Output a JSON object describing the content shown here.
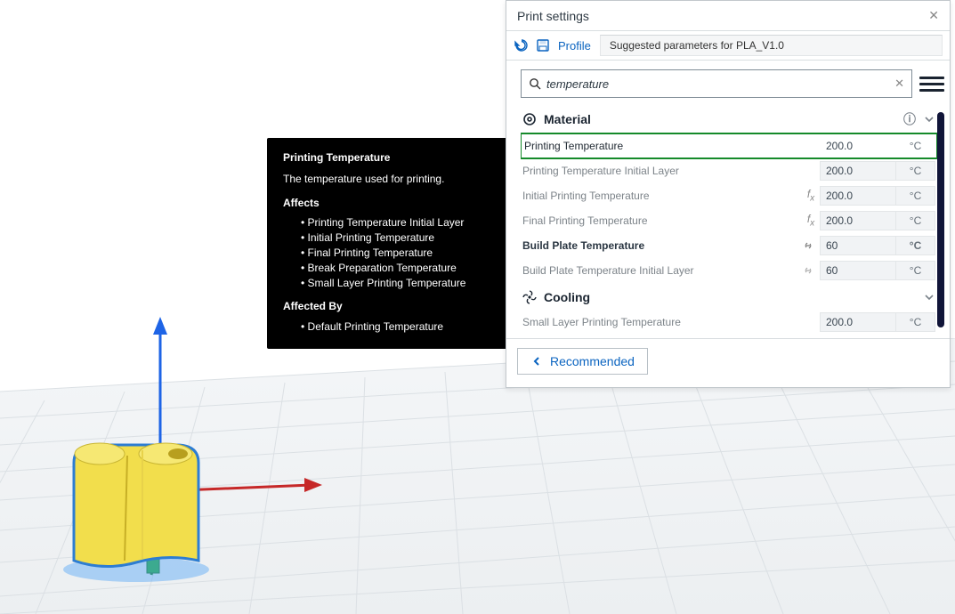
{
  "tooltip": {
    "title": "Printing Temperature",
    "desc": "The temperature used for printing.",
    "affects_label": "Affects",
    "affects": [
      "Printing Temperature Initial Layer",
      "Initial Printing Temperature",
      "Final Printing Temperature",
      "Break Preparation Temperature",
      "Small Layer Printing Temperature"
    ],
    "affected_by_label": "Affected By",
    "affected_by": [
      "Default Printing Temperature"
    ]
  },
  "panel": {
    "title": "Print settings",
    "close_glyph": "✕",
    "undo_glyph": "↺",
    "save_glyph": "🖫",
    "profile_label": "Profile",
    "profile_value": "Suggested parameters for PLA_V1.0",
    "search_value": "temperature",
    "search_glyph": "🔍",
    "search_clear": "✕",
    "info_glyph": "ⓘ",
    "sections": {
      "material": {
        "title": "Material",
        "icon": "material-icon",
        "rows": [
          {
            "label": "Printing Temperature",
            "value": "200.0",
            "unit": "°C",
            "name": "printing-temperature",
            "highlight": true,
            "enabled": true
          },
          {
            "label": "Printing Temperature Initial Layer",
            "value": "200.0",
            "unit": "°C",
            "name": "printing-temperature-initial-layer"
          },
          {
            "label": "Initial Printing Temperature",
            "value": "200.0",
            "unit": "°C",
            "name": "initial-printing-temperature",
            "pre": "fx"
          },
          {
            "label": "Final Printing Temperature",
            "value": "200.0",
            "unit": "°C",
            "name": "final-printing-temperature",
            "pre": "fx"
          },
          {
            "label": "Build Plate Temperature",
            "value": "60",
            "unit": "°C",
            "name": "build-plate-temperature",
            "pre": "link",
            "enabled": true
          },
          {
            "label": "Build Plate Temperature Initial Layer",
            "value": "60",
            "unit": "°C",
            "name": "build-plate-temperature-initial-layer",
            "pre": "link"
          }
        ]
      },
      "cooling": {
        "title": "Cooling",
        "icon": "fan-icon",
        "rows": [
          {
            "label": "Small Layer Printing Temperature",
            "value": "200.0",
            "unit": "°C",
            "name": "small-layer-printing-temperature"
          }
        ]
      }
    },
    "recommended_label": "Recommended"
  }
}
